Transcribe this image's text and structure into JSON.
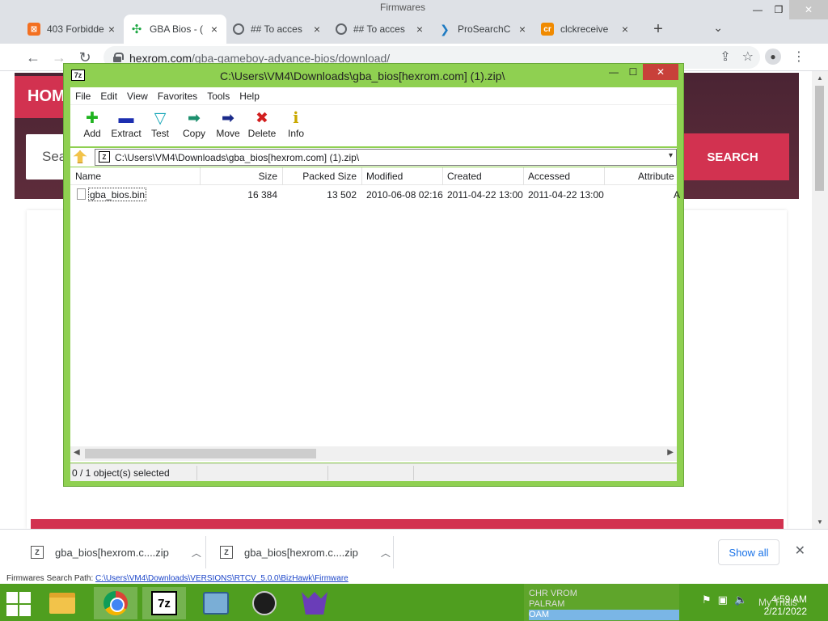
{
  "browser": {
    "window_title": "Firmwares",
    "tabs": [
      {
        "label": "403 Forbidde",
        "icon": "xampp-icon",
        "active": false
      },
      {
        "label": "GBA Bios - (",
        "icon": "gamepad-icon",
        "active": true
      },
      {
        "label": "## To acces",
        "icon": "globe-icon",
        "active": false
      },
      {
        "label": "## To acces",
        "icon": "globe-icon",
        "active": false
      },
      {
        "label": "ProSearchC",
        "icon": "arrow-icon",
        "active": false
      },
      {
        "label": "clckreceive",
        "icon": "cr-icon",
        "active": false
      }
    ],
    "url_domain": "hexrom.com",
    "url_path": "/gba-gameboy-advance-bios/download/"
  },
  "website": {
    "home_label": "HOM",
    "search_placeholder": "Sea",
    "search_button": "SEARCH"
  },
  "sevenzip": {
    "title": "C:\\Users\\VM4\\Downloads\\gba_bios[hexrom.com] (1).zip\\",
    "menu": [
      "File",
      "Edit",
      "View",
      "Favorites",
      "Tools",
      "Help"
    ],
    "toolbar": [
      {
        "label": "Add",
        "icon": "plus-icon",
        "glyph": "✚",
        "color": "#1fb31f"
      },
      {
        "label": "Extract",
        "icon": "minus-icon",
        "glyph": "▬",
        "color": "#1c2fb0"
      },
      {
        "label": "Test",
        "icon": "check-arrow-icon",
        "glyph": "▽",
        "color": "#19a7b8"
      },
      {
        "label": "Copy",
        "icon": "copy-arrow-icon",
        "glyph": "➡",
        "color": "#1c8f6d"
      },
      {
        "label": "Move",
        "icon": "move-arrow-icon",
        "glyph": "➡",
        "color": "#1a2a8a"
      },
      {
        "label": "Delete",
        "icon": "delete-x-icon",
        "glyph": "✖",
        "color": "#d21f1f"
      },
      {
        "label": "Info",
        "icon": "info-icon",
        "glyph": "ℹ",
        "color": "#c9a800"
      }
    ],
    "address": "C:\\Users\\VM4\\Downloads\\gba_bios[hexrom.com] (1).zip\\",
    "columns": [
      "Name",
      "Size",
      "Packed Size",
      "Modified",
      "Created",
      "Accessed",
      "Attribute"
    ],
    "files": [
      {
        "name": "gba_bios.bin",
        "size": "16 384",
        "packed": "13 502",
        "modified": "2010-06-08 02:16",
        "created": "2011-04-22 13:00",
        "accessed": "2011-04-22 13:00",
        "attr": "A"
      }
    ],
    "status": "0 / 1 object(s) selected"
  },
  "downloads": {
    "items": [
      {
        "label": "gba_bios[hexrom.c....zip"
      },
      {
        "label": "gba_bios[hexrom.c....zip"
      }
    ],
    "show_all": "Show all"
  },
  "behind_window": {
    "label": "Firmwares Search Path:",
    "path": "C:\\Users\\VM4\\Downloads\\VERSIONS\\RTCV_5.0.0\\BizHawk\\Firmware"
  },
  "taskbar": {
    "panel_lines": [
      "CHR VROM",
      "PALRAM",
      "OAM"
    ],
    "watermark": "My Trials",
    "time": "4:59 AM",
    "date": "2/21/2022"
  }
}
